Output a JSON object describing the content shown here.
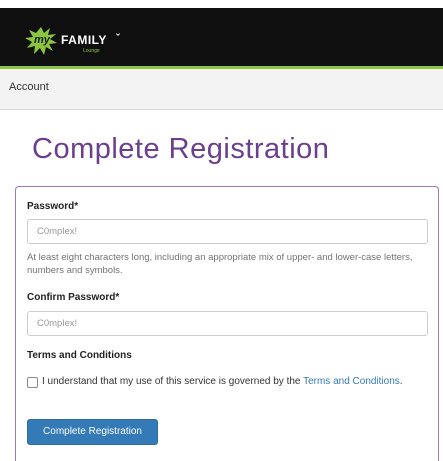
{
  "brand": {
    "logo_my": "my",
    "logo_family": "FAMILY",
    "logo_caret": "ˇ",
    "logo_lounge": "Lounge",
    "accent_color": "#8cc63f"
  },
  "nav": {
    "account_label": "Account"
  },
  "page": {
    "title": "Complete Registration",
    "title_color": "#6b3f8f"
  },
  "form": {
    "password_label": "Password*",
    "password_value": "C0mplex!",
    "password_help": "At least eight characters long, including an appropriate mix of upper- and lower-case letters, numbers and symbols.",
    "confirm_label": "Confirm Password*",
    "confirm_value": "C0mplex!",
    "terms_heading": "Terms and Conditions",
    "terms_text": "I understand that my use of this service is governed by the ",
    "terms_link": "Terms and Conditions",
    "terms_period": ".",
    "terms_checked": false,
    "submit_label": "Complete Registration",
    "button_color": "#337ab7",
    "link_color": "#337ab7"
  }
}
